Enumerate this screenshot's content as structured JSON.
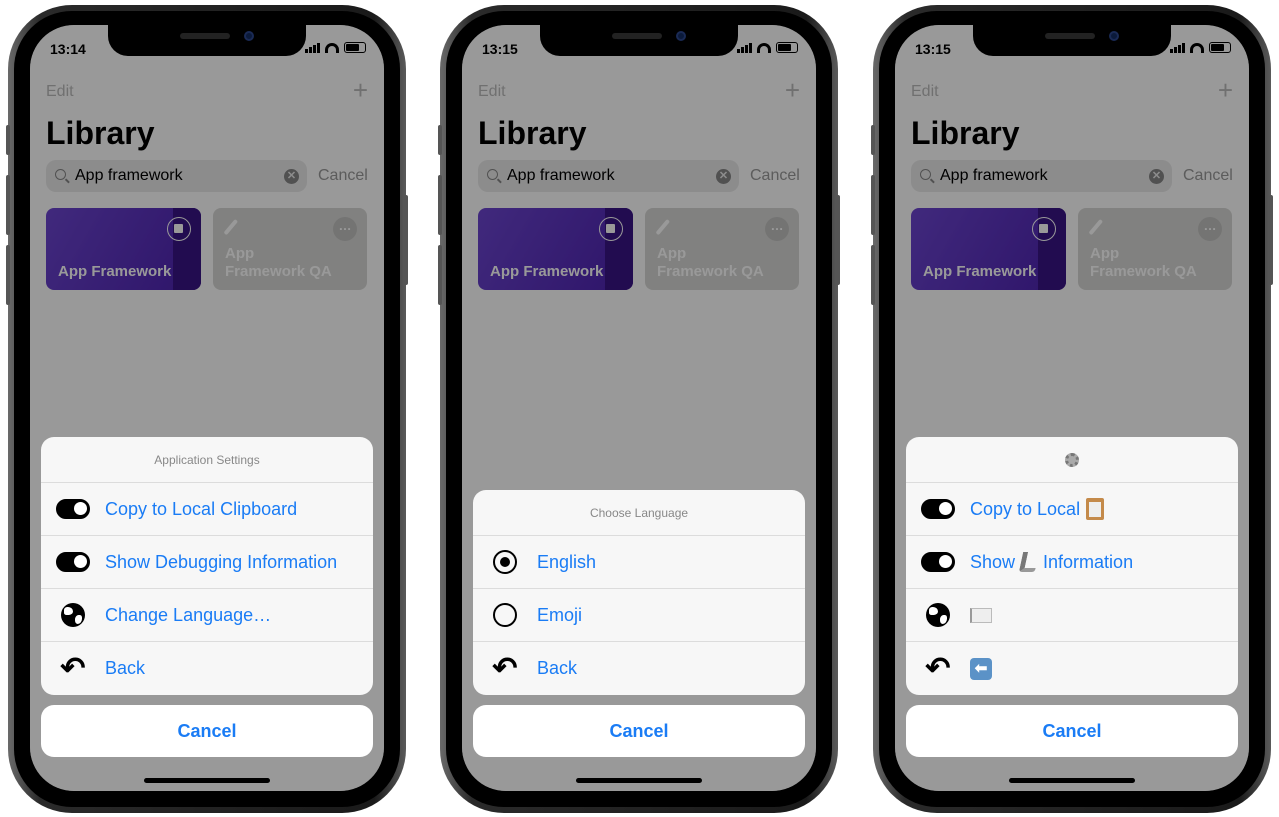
{
  "colors": {
    "accent": "#1a7cf5",
    "card_purple": "#5b30c0",
    "sheet_bg": "#f7f7f7"
  },
  "phones": [
    {
      "status_time": "13:14",
      "nav": {
        "edit": "Edit",
        "add_icon": "plus-icon"
      },
      "title": "Library",
      "search": {
        "value": "App framework",
        "cancel": "Cancel"
      },
      "cards": [
        {
          "label": "App Framework",
          "icon": "stop-icon"
        },
        {
          "label": "App Framework QA",
          "icon": "magic-wand-icon"
        }
      ],
      "sheet": {
        "header": "Application Settings",
        "header_icon": null,
        "rows": [
          {
            "icon": "toggle-on-icon",
            "parts": [
              {
                "text": "Copy to Local Clipboard"
              }
            ]
          },
          {
            "icon": "toggle-off-icon",
            "parts": [
              {
                "text": "Show Debugging Information"
              }
            ]
          },
          {
            "icon": "globe-icon",
            "parts": [
              {
                "text": "Change Language…"
              }
            ]
          },
          {
            "icon": "back-arrow-icon",
            "parts": [
              {
                "text": "Back"
              }
            ]
          }
        ],
        "cancel": "Cancel"
      }
    },
    {
      "status_time": "13:15",
      "nav": {
        "edit": "Edit",
        "add_icon": "plus-icon"
      },
      "title": "Library",
      "search": {
        "value": "App framework",
        "cancel": "Cancel"
      },
      "cards": [
        {
          "label": "App Framework",
          "icon": "stop-icon"
        },
        {
          "label": "App Framework QA",
          "icon": "magic-wand-icon"
        }
      ],
      "sheet": {
        "header": "Choose Language",
        "header_icon": null,
        "rows": [
          {
            "icon": "radio-selected-icon",
            "parts": [
              {
                "text": "English"
              }
            ]
          },
          {
            "icon": "radio-unselected-icon",
            "parts": [
              {
                "text": "Emoji"
              }
            ]
          },
          {
            "icon": "back-arrow-icon",
            "parts": [
              {
                "text": "Back"
              }
            ]
          }
        ],
        "cancel": "Cancel"
      }
    },
    {
      "status_time": "13:15",
      "nav": {
        "edit": "Edit",
        "add_icon": "plus-icon"
      },
      "title": "Library",
      "search": {
        "value": "App framework",
        "cancel": "Cancel"
      },
      "cards": [
        {
          "label": "App Framework",
          "icon": "stop-icon"
        },
        {
          "label": "App Framework QA",
          "icon": "magic-wand-icon"
        }
      ],
      "sheet": {
        "header": "",
        "header_icon": "gear-emoji-icon",
        "rows": [
          {
            "icon": "toggle-on-icon",
            "parts": [
              {
                "text": "Copy to Local"
              },
              {
                "emoji": "clipboard-emoji-icon"
              }
            ]
          },
          {
            "icon": "toggle-off-icon",
            "parts": [
              {
                "text": "Show"
              },
              {
                "emoji": "microscope-emoji-icon"
              },
              {
                "text": "Information"
              }
            ]
          },
          {
            "icon": "globe-icon",
            "parts": [
              {
                "emoji": "white-flag-emoji-icon"
              }
            ]
          },
          {
            "icon": "back-arrow-icon",
            "parts": [
              {
                "emoji": "back-arrow-emoji-icon"
              }
            ]
          }
        ],
        "cancel": "Cancel"
      }
    }
  ]
}
